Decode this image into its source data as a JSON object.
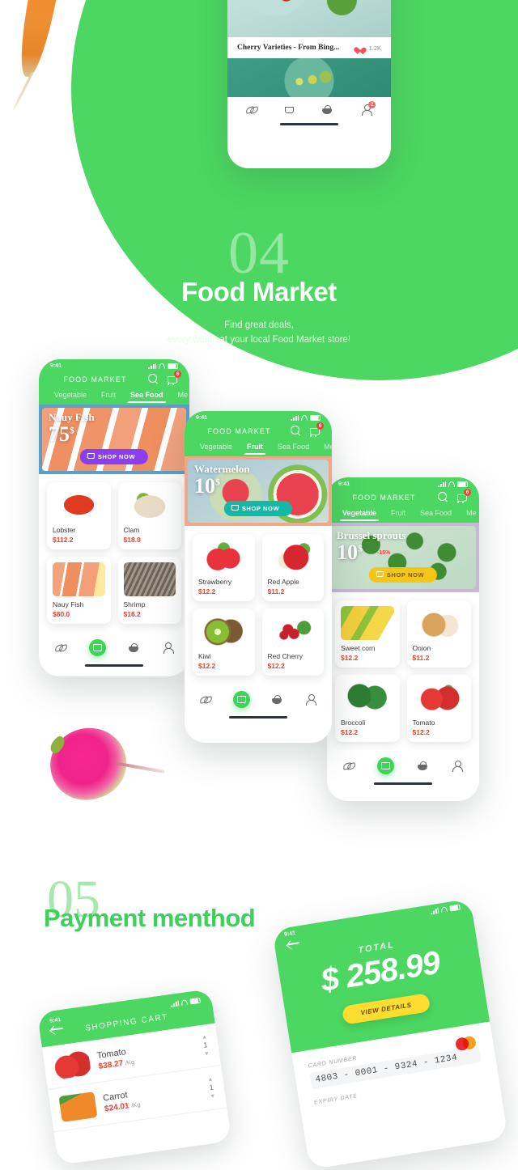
{
  "theme": {
    "green": "#4BD761",
    "red": "#F2402B",
    "yellow": "#FFDD2E",
    "pale_green": "#97E6A3"
  },
  "section_food_market": {
    "number": "04",
    "title": "Food Market",
    "subtitle_line1": "Find great deals,",
    "subtitle_line2": "every week, at your local Food Market store!"
  },
  "section_payment": {
    "number": "05",
    "title": "Payment menthod"
  },
  "feed_phone": {
    "post_title": "Cherry Varieties - From Bing...",
    "likes": "1.2K",
    "nav": [
      "leaf-icon",
      "cart-icon",
      "basket-icon",
      "user-icon"
    ],
    "user_badge": "2"
  },
  "phone_seafood": {
    "status_time": "9:41",
    "brand": "FOOD MARKET",
    "cart_badge": "6",
    "tabs": [
      {
        "label": "Vegetable",
        "active": false
      },
      {
        "label": "Fruit",
        "active": false
      },
      {
        "label": "Sea Food",
        "active": true
      },
      {
        "label": "Me",
        "active": false
      }
    ],
    "banner": {
      "title": "Nauy Fish",
      "price": "75",
      "currency": "$",
      "cta": "SHOP NOW"
    },
    "products": [
      {
        "name": "Lobster",
        "price": "$112.2"
      },
      {
        "name": "Clam",
        "price": "$18.0"
      },
      {
        "name": "Nauy Fish",
        "price": "$80.0"
      },
      {
        "name": "Shrimp",
        "price": "$16.2"
      }
    ]
  },
  "phone_fruit": {
    "status_time": "9:41",
    "brand": "FOOD MARKET",
    "cart_badge": "6",
    "tabs": [
      {
        "label": "Vegetable",
        "active": false
      },
      {
        "label": "Fruit",
        "active": true
      },
      {
        "label": "Sea Food",
        "active": false
      },
      {
        "label": "Me",
        "active": false
      }
    ],
    "banner": {
      "title": "Watermelon",
      "price": "10",
      "currency": "$",
      "cta": "SHOP NOW"
    },
    "products": [
      {
        "name": "Strawberry",
        "price": "$12.2"
      },
      {
        "name": "Red Apple",
        "price": "$11.2"
      },
      {
        "name": "Kiwi",
        "price": "$12.2"
      },
      {
        "name": "Red Cherry",
        "price": "$12.2"
      }
    ]
  },
  "phone_vegetable": {
    "status_time": "9:41",
    "brand": "FOOD MARKET",
    "cart_badge": "6",
    "tabs": [
      {
        "label": "Vegetable",
        "active": true
      },
      {
        "label": "Fruit",
        "active": false
      },
      {
        "label": "Sea Food",
        "active": false
      },
      {
        "label": "Me",
        "active": false
      }
    ],
    "banner": {
      "title": "Brussel sprouts",
      "price": "10",
      "currency": "$",
      "off": "-15%",
      "cta": "SHOP NOW"
    },
    "products": [
      {
        "name": "Sweet corn",
        "price": "$12.2"
      },
      {
        "name": "Onion",
        "price": "$11.2"
      },
      {
        "name": "Broccoli",
        "price": "$12.2"
      },
      {
        "name": "Tomato",
        "price": "$12.2"
      }
    ]
  },
  "phone_payment": {
    "status_time": "9:41",
    "total_label": "TOTAL",
    "total_amount": "$ 258.99",
    "view_details": "VIEW DETAILS",
    "card_number_label": "CARD NUMBER",
    "card_number_value": "4803 - 0001 - 9324 - 1234",
    "expiry_label": "EXPIRY DATE"
  },
  "phone_cart": {
    "status_time": "9:41",
    "title": "SHOPPING CART",
    "items": [
      {
        "name": "Tomato",
        "price": "$38.27",
        "unit": "/Kg",
        "qty": "1"
      },
      {
        "name": "Carrot",
        "price": "$24.01",
        "unit": "/Kg",
        "qty": "1"
      }
    ]
  }
}
